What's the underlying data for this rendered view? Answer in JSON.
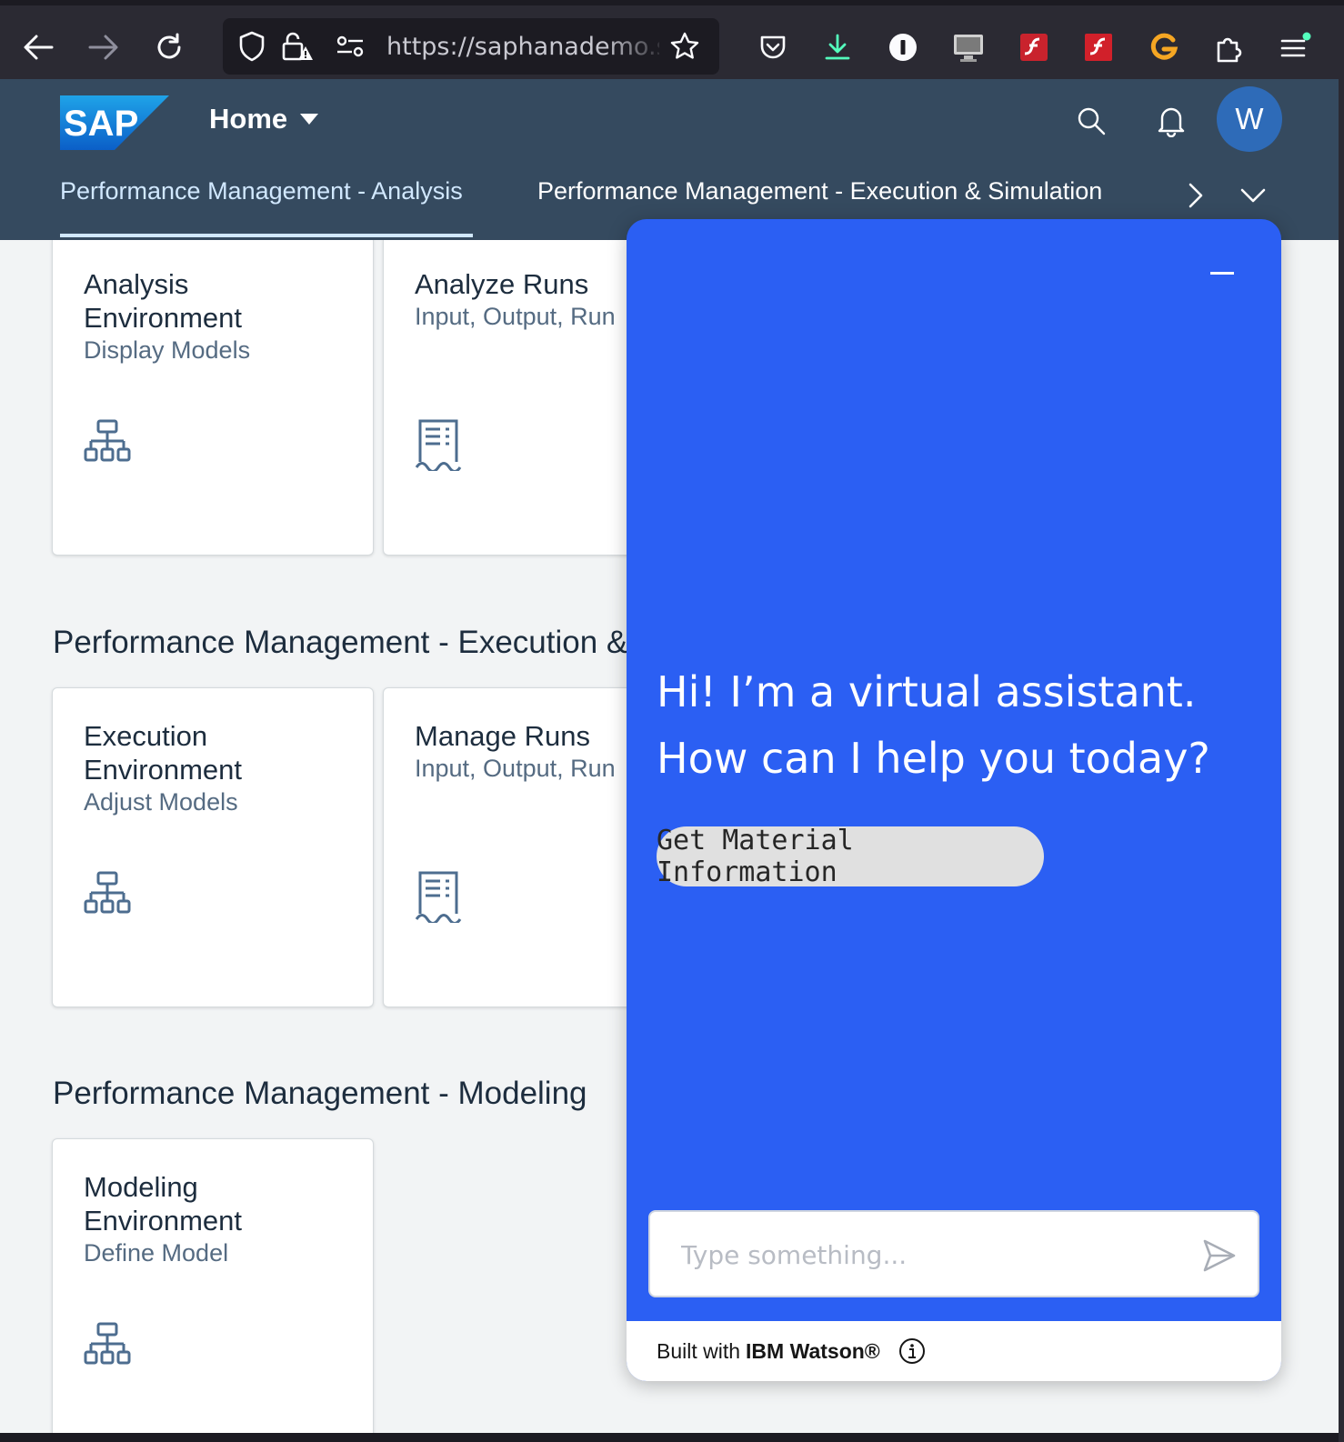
{
  "browser": {
    "url": "https://saphanademo.sap",
    "colors": {
      "toolbar": "#2b2a33",
      "urlbar": "#1c1b22"
    }
  },
  "shell": {
    "logo_text": "SAP",
    "home_label": "Home",
    "avatar_initial": "W",
    "tabs": [
      {
        "label": "Performance Management - Analysis"
      },
      {
        "label": "Performance Management - Execution & Simulation"
      }
    ],
    "colors": {
      "background": "#354a5f",
      "active_tab": "#d1e8ff"
    }
  },
  "groups": [
    {
      "tiles": [
        {
          "title": "Analysis Environment",
          "title_line1": "Analysis",
          "title_line2": "Environment",
          "subtitle": "Display Models",
          "icon": "hierarchy-icon"
        },
        {
          "title": "Analyze Runs",
          "subtitle": "Input, Output, Run",
          "icon": "receipt-icon"
        }
      ]
    },
    {
      "title": "Performance Management - Execution &",
      "tiles": [
        {
          "title_line1": "Execution",
          "title_line2": "Environment",
          "subtitle": "Adjust Models",
          "icon": "hierarchy-icon"
        },
        {
          "title": "Manage Runs",
          "subtitle": "Input, Output, Run",
          "icon": "receipt-icon"
        }
      ]
    },
    {
      "title": "Performance Management - Modeling",
      "tiles": [
        {
          "title_line1": "Modeling",
          "title_line2": "Environment",
          "subtitle": "Define Model",
          "icon": "hierarchy-icon"
        }
      ]
    }
  ],
  "chat": {
    "greeting": "Hi! I’m a virtual assistant. How can I help you today?",
    "suggestion": "Get Material Information",
    "input_placeholder": "Type something...",
    "footer_prefix": "Built with",
    "footer_brand": "IBM Watson®",
    "colors": {
      "panel": "#2b5ff3",
      "chip": "#e0e0e0"
    }
  }
}
